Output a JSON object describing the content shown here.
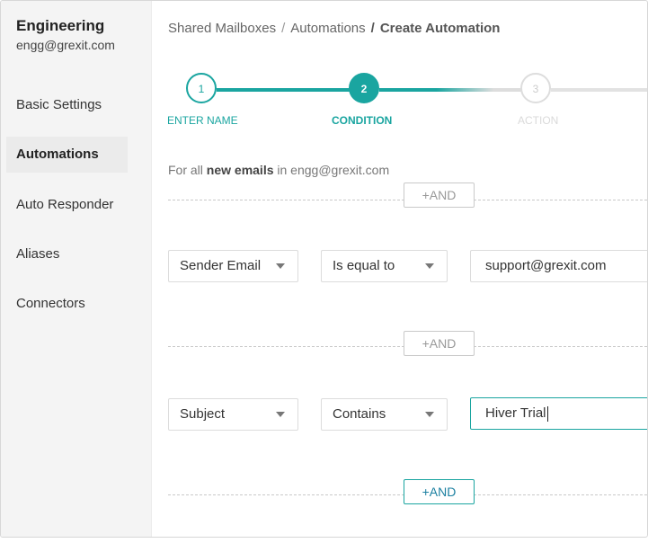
{
  "sidebar": {
    "team_name": "Engineering",
    "team_email": "engg@grexit.com",
    "items": [
      {
        "label": "Basic Settings",
        "active": false
      },
      {
        "label": "Automations",
        "active": true
      },
      {
        "label": "Auto Responder",
        "active": false
      },
      {
        "label": "Aliases",
        "active": false
      },
      {
        "label": "Connectors",
        "active": false
      }
    ]
  },
  "breadcrumb": {
    "items": [
      "Shared Mailboxes",
      "Automations",
      "Create Automation"
    ],
    "separator": "/"
  },
  "stepper": {
    "steps": [
      {
        "number": "1",
        "label": "ENTER NAME",
        "state": "completed"
      },
      {
        "number": "2",
        "label": "CONDITION",
        "state": "current"
      },
      {
        "number": "3",
        "label": "ACTION",
        "state": "upcoming"
      }
    ]
  },
  "conditions": {
    "intro_prefix": "For all",
    "intro_emphasis": "new emails",
    "intro_suffix": "in engg@grexit.com",
    "and_label": "+AND",
    "rows": [
      {
        "field": "Sender Email",
        "operator": "Is equal to",
        "value": "support@grexit.com",
        "focused": false
      },
      {
        "field": "Subject",
        "operator": "Contains",
        "value": "Hiver Trial",
        "focused": true
      }
    ]
  },
  "colors": {
    "accent": "#1aa5a0",
    "sidebar_bg": "#f4f4f4",
    "inactive": "#dddddd"
  }
}
